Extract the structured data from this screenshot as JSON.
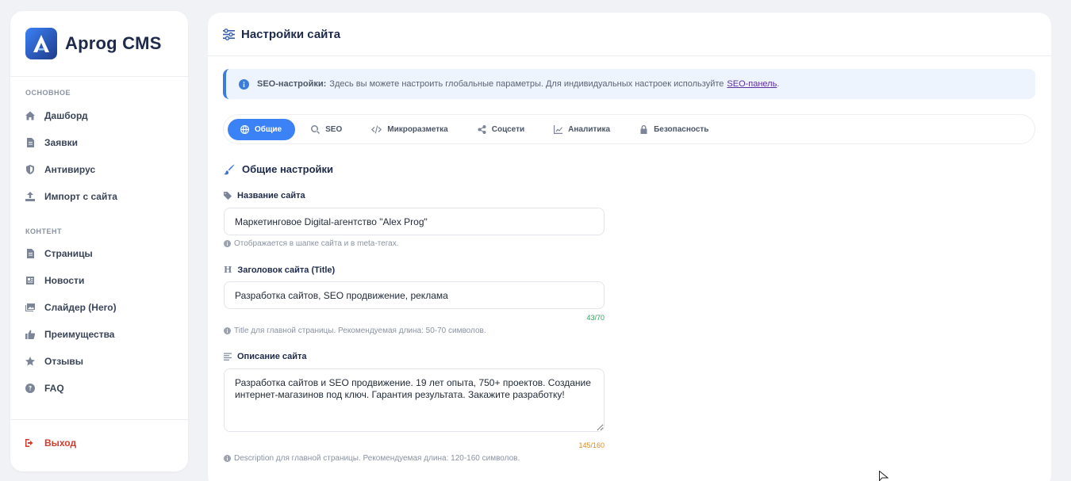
{
  "brand": {
    "name": "Aprog CMS"
  },
  "sidebar": {
    "sections": [
      {
        "title": "ОСНОВНОЕ",
        "items": [
          {
            "label": "Дашборд",
            "icon": "home-icon"
          },
          {
            "label": "Заявки",
            "icon": "file-icon"
          },
          {
            "label": "Антивирус",
            "icon": "shield-icon"
          },
          {
            "label": "Импорт с сайта",
            "icon": "upload-icon"
          }
        ]
      },
      {
        "title": "КОНТЕНТ",
        "items": [
          {
            "label": "Страницы",
            "icon": "file-icon"
          },
          {
            "label": "Новости",
            "icon": "newspaper-icon"
          },
          {
            "label": "Слайдер (Hero)",
            "icon": "images-icon"
          },
          {
            "label": "Преимущества",
            "icon": "thumbs-up-icon"
          },
          {
            "label": "Отзывы",
            "icon": "star-icon"
          },
          {
            "label": "FAQ",
            "icon": "question-icon"
          }
        ]
      }
    ],
    "logout": "Выход"
  },
  "header": {
    "title": "Настройки сайта"
  },
  "alert": {
    "bold": "SEO-настройки:",
    "text": "Здесь вы можете настроить глобальные параметры. Для индивидуальных настроек используйте",
    "link": "SEO-панель",
    "end": "."
  },
  "tabs": [
    {
      "label": "Общие",
      "icon": "globe-icon",
      "active": true
    },
    {
      "label": "SEO",
      "icon": "search-icon"
    },
    {
      "label": "Микроразметка",
      "icon": "code-icon"
    },
    {
      "label": "Соцсети",
      "icon": "share-icon"
    },
    {
      "label": "Аналитика",
      "icon": "chart-line-icon"
    },
    {
      "label": "Безопасность",
      "icon": "lock-icon"
    }
  ],
  "section": {
    "title": "Общие настройки"
  },
  "fields": {
    "site_name": {
      "label": "Название сайта",
      "value": "Маркетинговое Digital-агентство \"Alex Prog\"",
      "hint": "Отображается в шапке сайта и в meta-тегах."
    },
    "site_title": {
      "label": "Заголовок сайта (Title)",
      "value": "Разработка сайтов, SEO продвижение, реклама",
      "counter": "43/70",
      "hint": "Title для главной страницы. Рекомендуемая длина: 50-70 символов."
    },
    "site_description": {
      "label": "Описание сайта",
      "value": "Разработка сайтов и SEO продвижение. 19 лет опыта, 750+ проектов. Создание интернет-магазинов под ключ. Гарантия результата. Закажите разработку!",
      "counter": "145/160",
      "hint": "Description для главной страницы. Рекомендуемая длина: 120-160 символов."
    }
  },
  "colors": {
    "accent": "#3b82f6",
    "danger": "#d13b2c",
    "success": "#2e9e5b",
    "warning": "#d98a1c"
  }
}
